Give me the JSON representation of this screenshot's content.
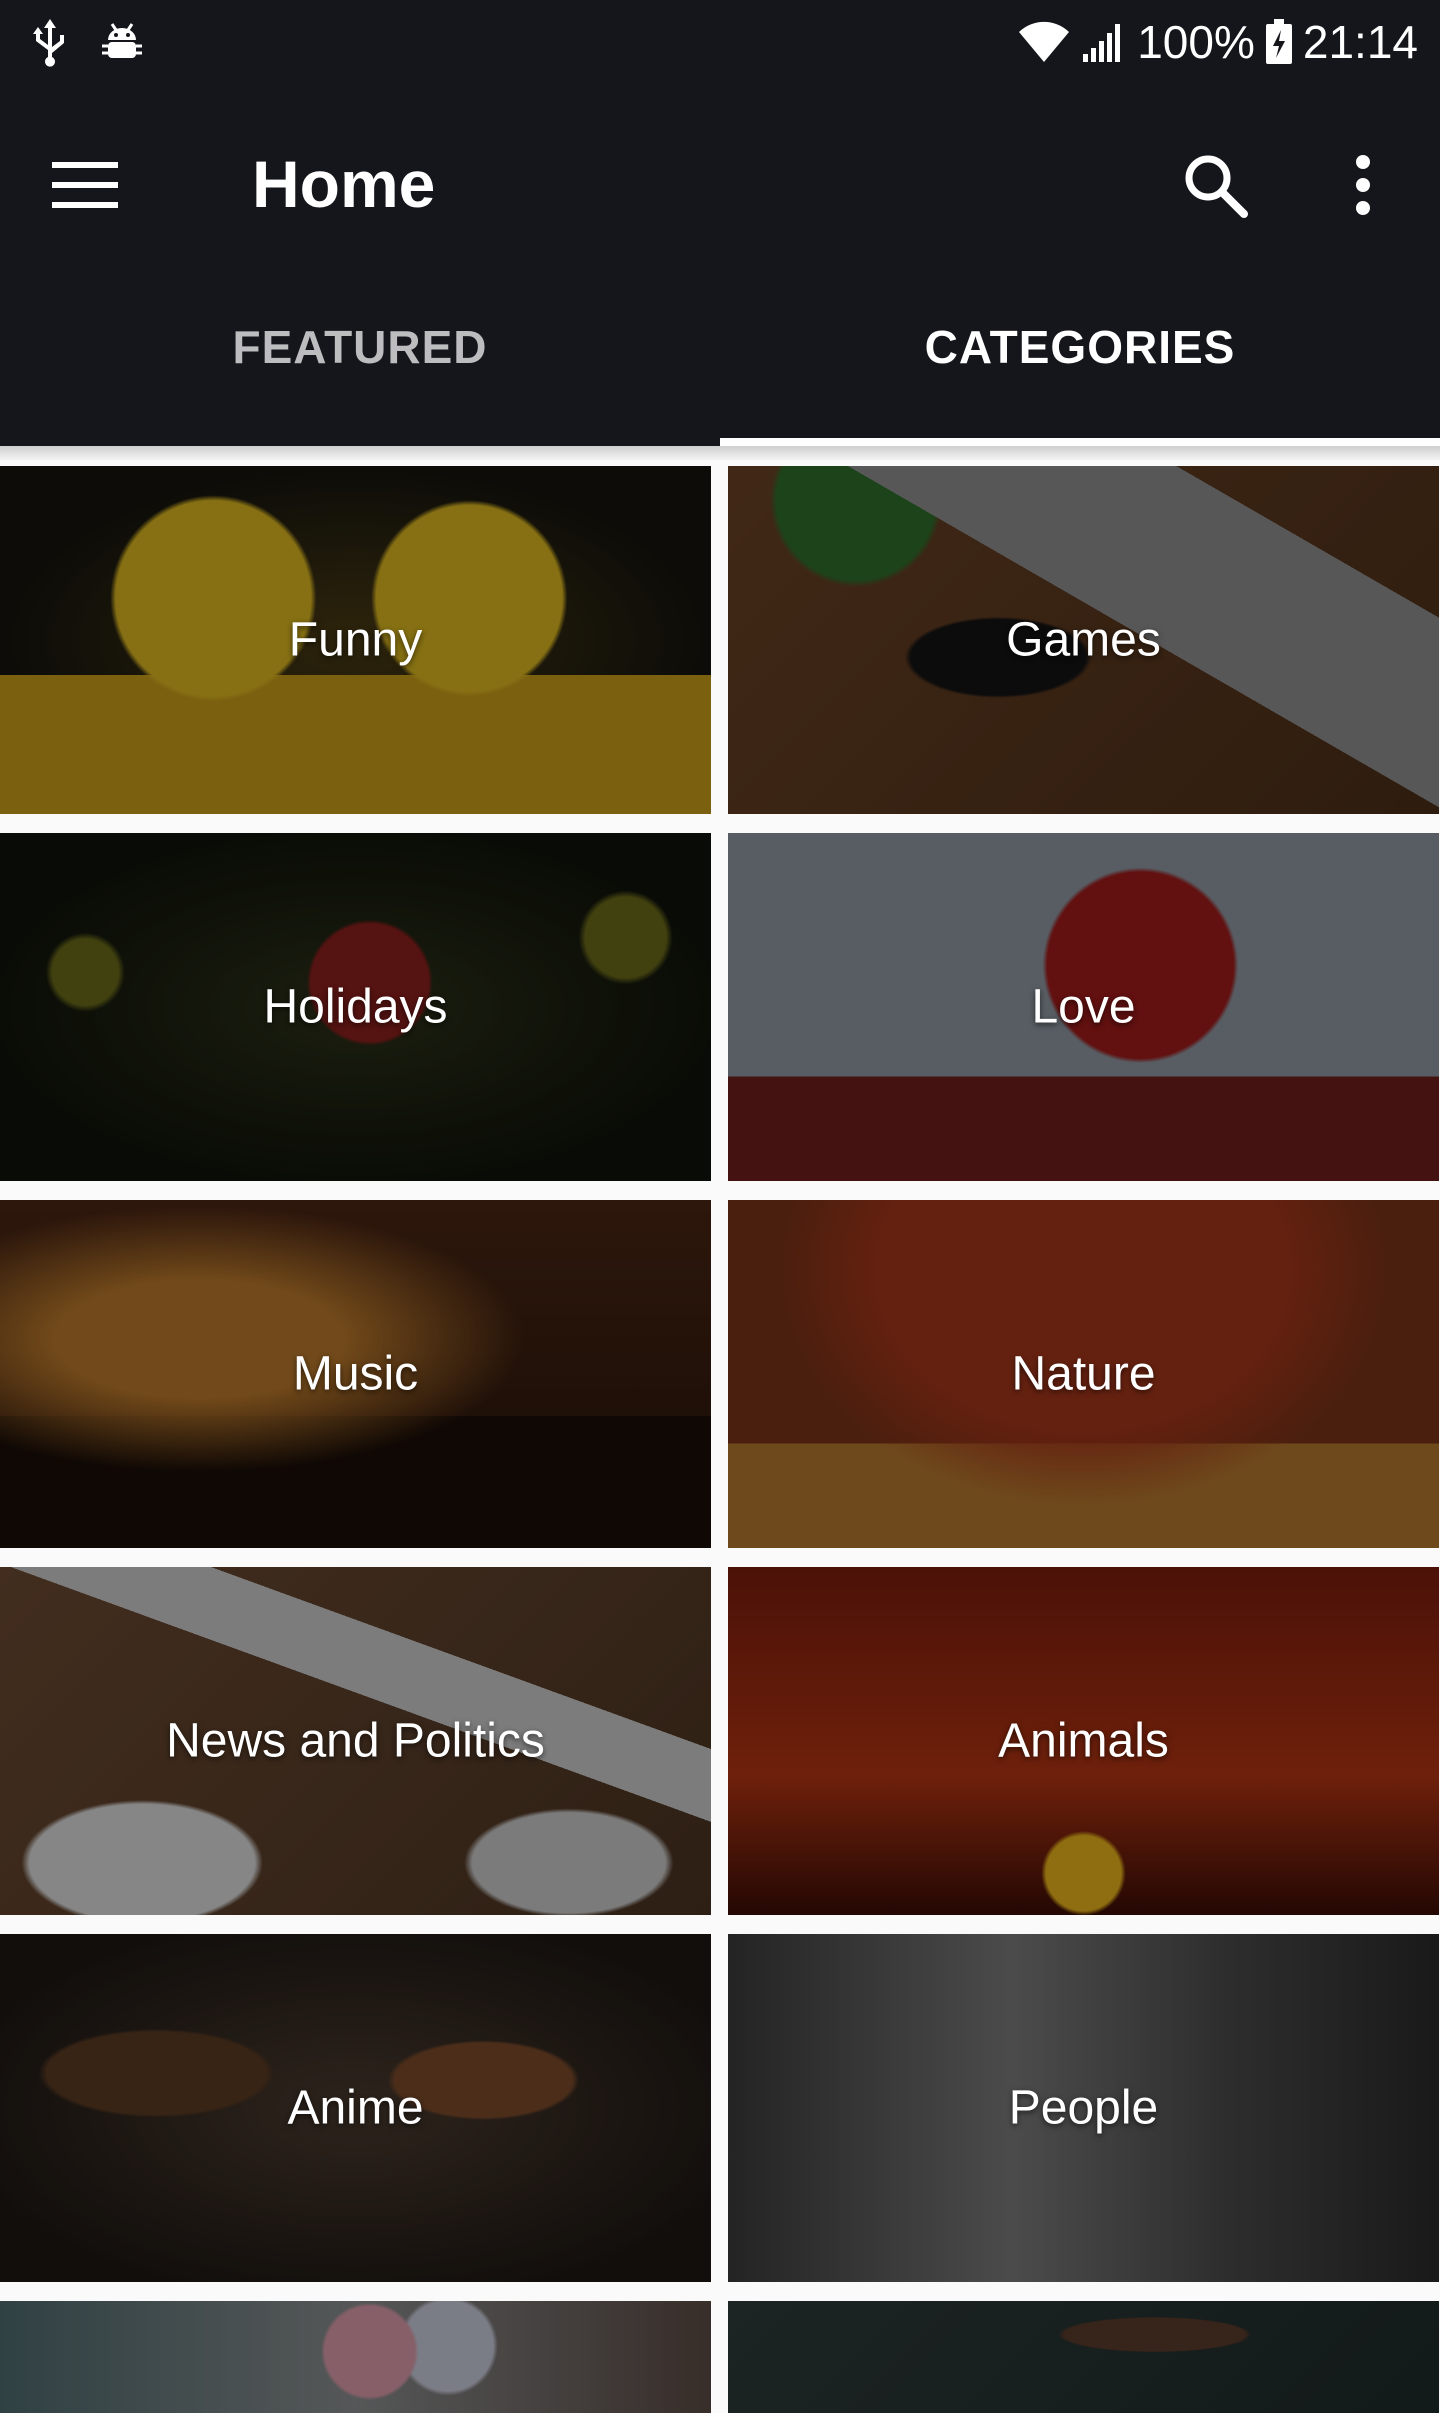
{
  "status_bar": {
    "battery_text": "100%",
    "time": "21:14",
    "icons": [
      "usb-icon",
      "android-debug-icon",
      "wifi-icon",
      "signal-icon",
      "battery-charging-icon"
    ]
  },
  "toolbar": {
    "title": "Home",
    "icons": [
      "menu-icon",
      "search-icon",
      "more-vert-icon"
    ]
  },
  "tabs": [
    {
      "label": "FEATURED",
      "active": false
    },
    {
      "label": "CATEGORIES",
      "active": true
    }
  ],
  "categories": [
    {
      "label": "Funny"
    },
    {
      "label": "Games"
    },
    {
      "label": "Holidays"
    },
    {
      "label": "Love"
    },
    {
      "label": "Music"
    },
    {
      "label": "Nature"
    },
    {
      "label": "News and Politics"
    },
    {
      "label": "Animals"
    },
    {
      "label": "Anime"
    },
    {
      "label": "People"
    }
  ],
  "colors": {
    "app_bar": "#15161b",
    "tab_indicator": "#ffffff",
    "background": "#fafafa"
  }
}
